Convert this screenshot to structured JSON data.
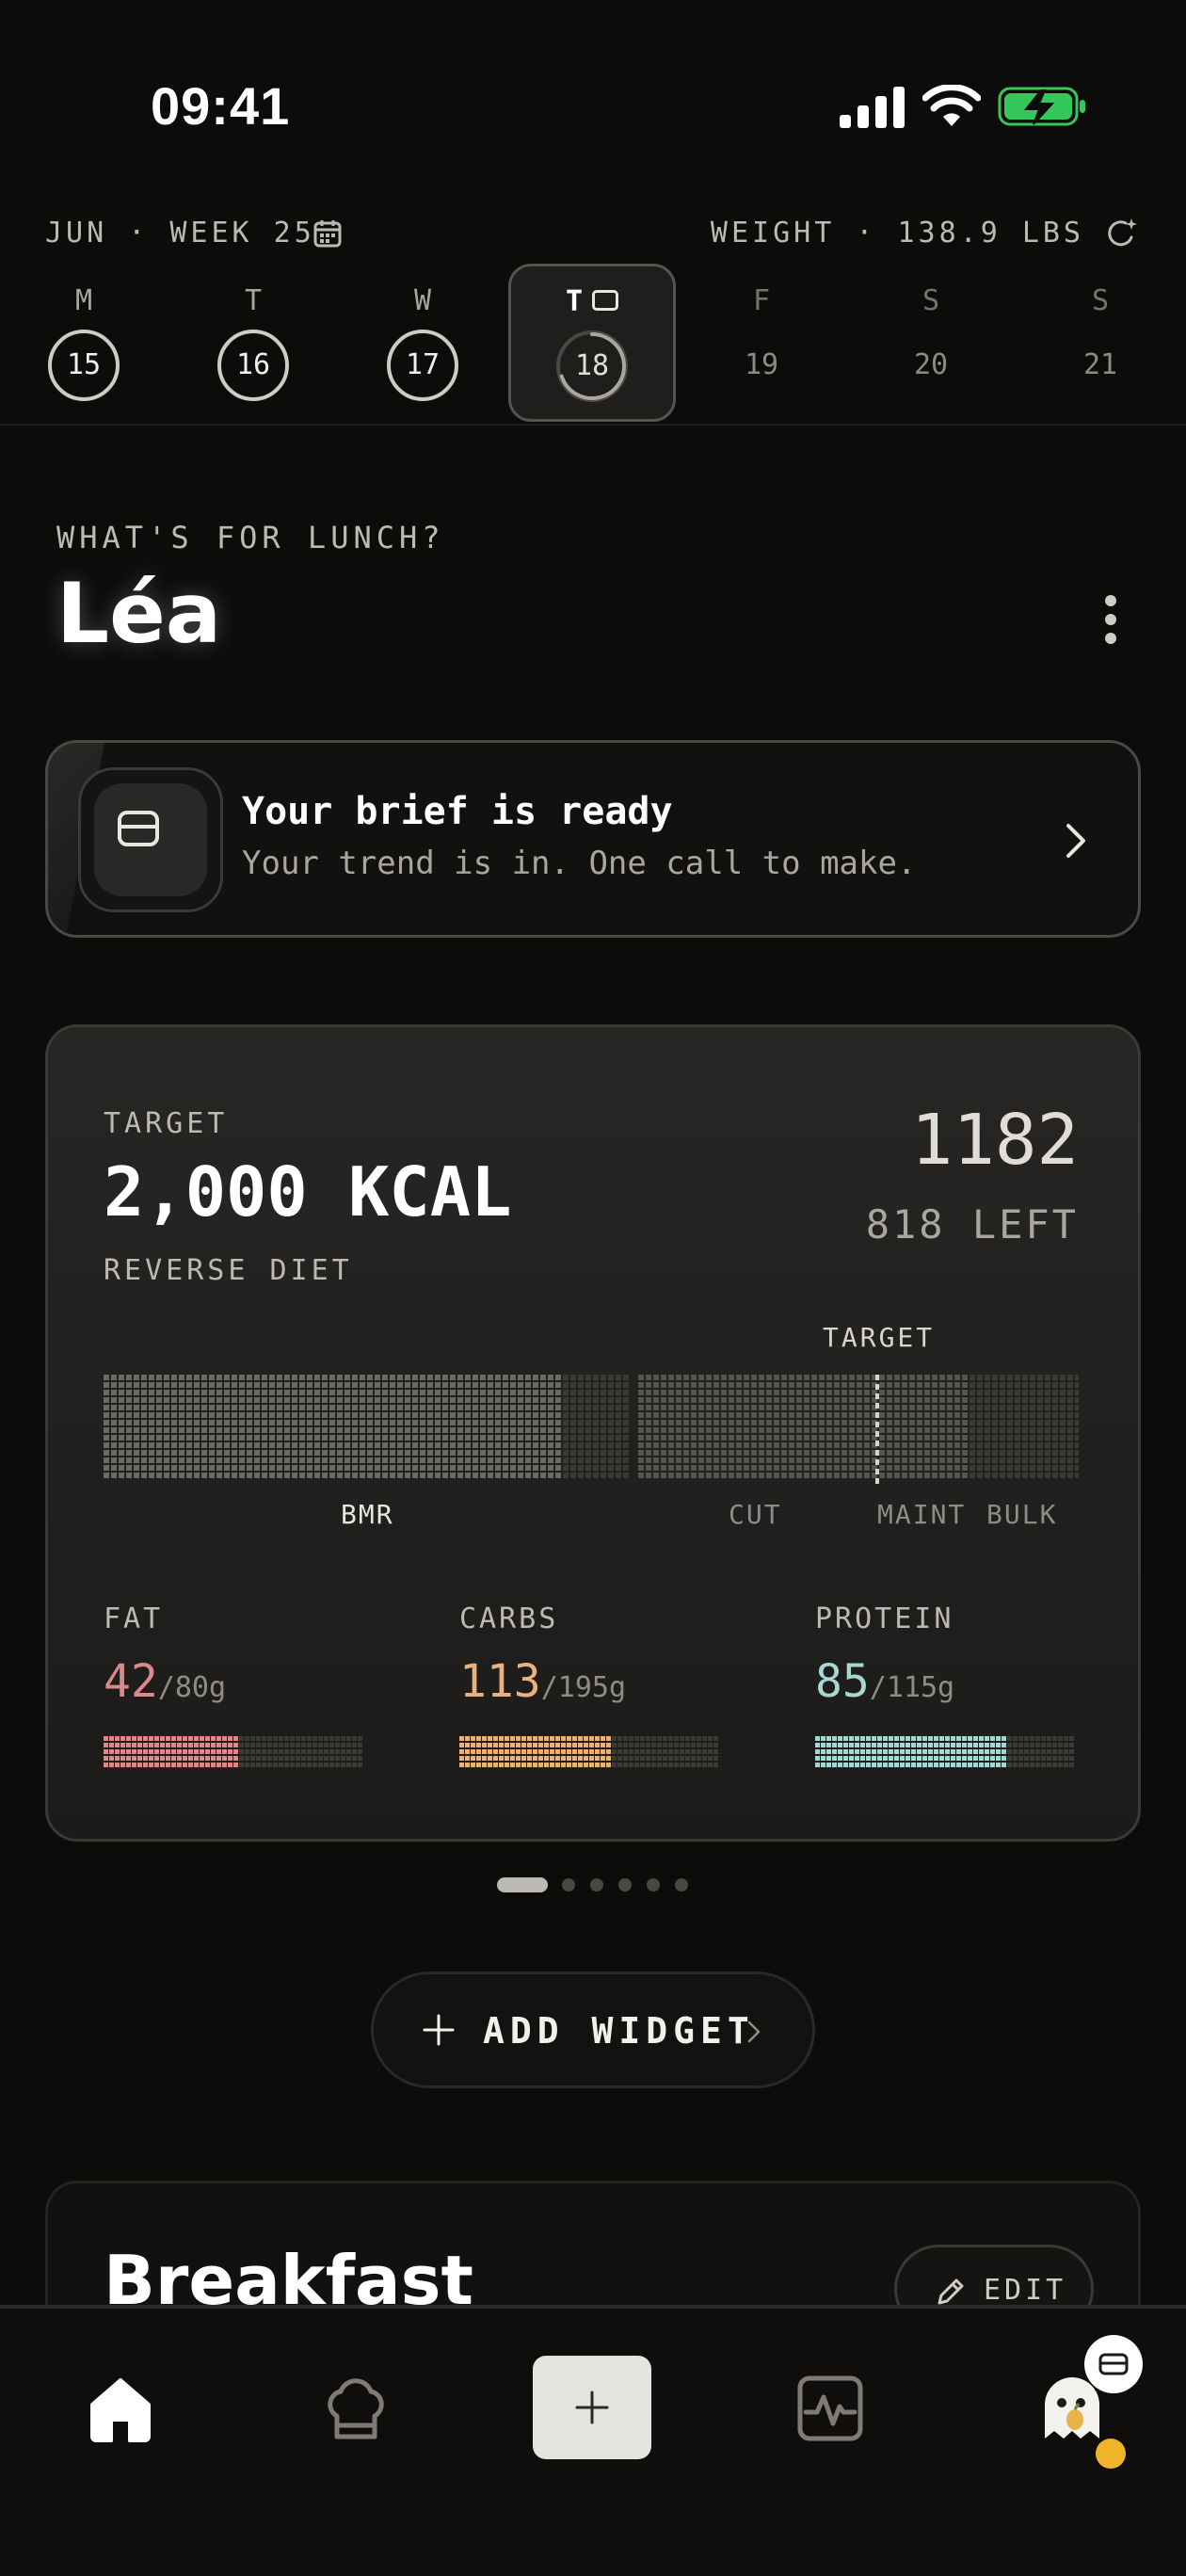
{
  "status_bar": {
    "time": "09:41"
  },
  "week_header": {
    "label": "JUN · WEEK 25",
    "weight": "WEIGHT · 138.9 LBS",
    "days": [
      {
        "letter": "M",
        "num": "15"
      },
      {
        "letter": "T",
        "num": "16"
      },
      {
        "letter": "W",
        "num": "17"
      },
      {
        "letter": "T",
        "num": "18"
      },
      {
        "letter": "F",
        "num": "19"
      },
      {
        "letter": "S",
        "num": "20"
      },
      {
        "letter": "S",
        "num": "21"
      }
    ],
    "selected_day_progress": 0.7
  },
  "greeting": {
    "question": "WHAT'S FOR LUNCH?",
    "name": "Léa"
  },
  "brief": {
    "title": "Your brief is ready",
    "subtitle": "Your trend is in. One call to make."
  },
  "target_card": {
    "label": "TARGET",
    "value": "2,000 KCAL",
    "sub": "REVERSE DIET",
    "consumed": "1182",
    "left": "818 LEFT",
    "marker_label": "TARGET",
    "segments": [
      "BMR",
      "CUT",
      "MAINT",
      "BULK"
    ],
    "macros": [
      {
        "name": "FAT",
        "value": "42",
        "of": "/80g",
        "ratio": 0.525,
        "color": "#d98a8a"
      },
      {
        "name": "CARBS",
        "value": "113",
        "of": "/195g",
        "ratio": 0.58,
        "color": "#e8b280"
      },
      {
        "name": "PROTEIN",
        "value": "85",
        "of": "/115g",
        "ratio": 0.74,
        "color": "#a8d6d3"
      }
    ]
  },
  "pager": {
    "count": 6,
    "active": 0
  },
  "add_widget": {
    "label": "ADD WIDGET"
  },
  "breakfast": {
    "title": "Breakfast",
    "edit_label": "EDIT"
  },
  "colors": {
    "background": "#0c0c0b",
    "card": "#252422",
    "accent": "#f0b428"
  }
}
